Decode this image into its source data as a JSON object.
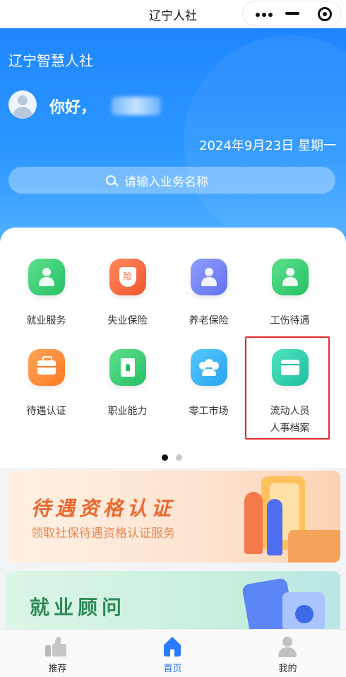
{
  "navbar": {
    "title": "辽宁人社"
  },
  "header": {
    "app_name": "辽宁智慧人社",
    "greeting": "你好，",
    "date": "2024年9月23日 星期一",
    "search_placeholder": "请输入业务名称"
  },
  "services": [
    {
      "label": "就业服务",
      "icon": "employment-icon",
      "color": "#25c065"
    },
    {
      "label": "失业保险",
      "icon": "insurance-shield-icon",
      "color": "#f1542e"
    },
    {
      "label": "养老保险",
      "icon": "elderly-icon",
      "color": "#6272f0"
    },
    {
      "label": "工伤待遇",
      "icon": "worker-icon",
      "color": "#25c065"
    },
    {
      "label": "待遇认证",
      "icon": "briefcase-icon",
      "color": "#ff7a25"
    },
    {
      "label": "职业能力",
      "icon": "certificate-icon",
      "color": "#25c065"
    },
    {
      "label": "零工市场",
      "icon": "group-icon",
      "color": "#2aa4f2"
    },
    {
      "label_line1": "流动人员",
      "label_line2": "人事档案",
      "icon": "archive-box-icon",
      "color": "#1fbf9e"
    }
  ],
  "shield_glyph": "险",
  "pager": {
    "active": 1,
    "total": 2
  },
  "banners": [
    {
      "title": "待遇资格认证",
      "subtitle": "领取社保待遇资格认证服务"
    },
    {
      "title": "就业顾问",
      "subtitle": ""
    }
  ],
  "tabbar": [
    {
      "label": "推荐",
      "icon": "thumbs-up-icon",
      "active": false
    },
    {
      "label": "首页",
      "icon": "home-icon",
      "active": true
    },
    {
      "label": "我的",
      "icon": "user-icon",
      "active": false
    }
  ]
}
